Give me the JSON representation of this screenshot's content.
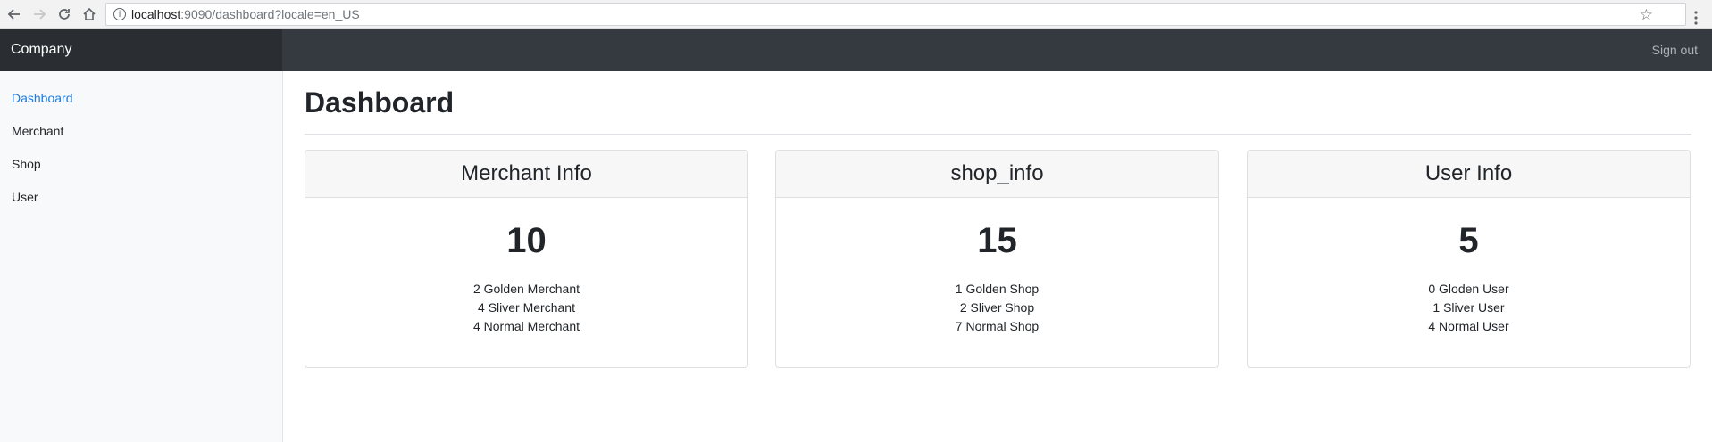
{
  "browser": {
    "url_host": "localhost",
    "url_rest": ":9090/dashboard?locale=en_US"
  },
  "navbar": {
    "brand": "Company",
    "sign_out": "Sign out"
  },
  "sidebar": {
    "items": [
      {
        "label": "Dashboard",
        "active": true
      },
      {
        "label": "Merchant",
        "active": false
      },
      {
        "label": "Shop",
        "active": false
      },
      {
        "label": "User",
        "active": false
      }
    ]
  },
  "main": {
    "title": "Dashboard",
    "cards": [
      {
        "header": "Merchant Info",
        "count": "10",
        "lines": [
          "2 Golden Merchant",
          "4 Sliver Merchant",
          "4 Normal Merchant"
        ]
      },
      {
        "header": "shop_info",
        "count": "15",
        "lines": [
          "1 Golden Shop",
          "2 Sliver Shop",
          "7 Normal Shop"
        ]
      },
      {
        "header": "User Info",
        "count": "5",
        "lines": [
          "0 Gloden User",
          "1 Sliver User",
          "4 Normal User"
        ]
      }
    ]
  },
  "colors": {
    "active_link": "#1a7be0",
    "navbar_bg": "#343a40",
    "brand_bg": "#2a2e33"
  }
}
